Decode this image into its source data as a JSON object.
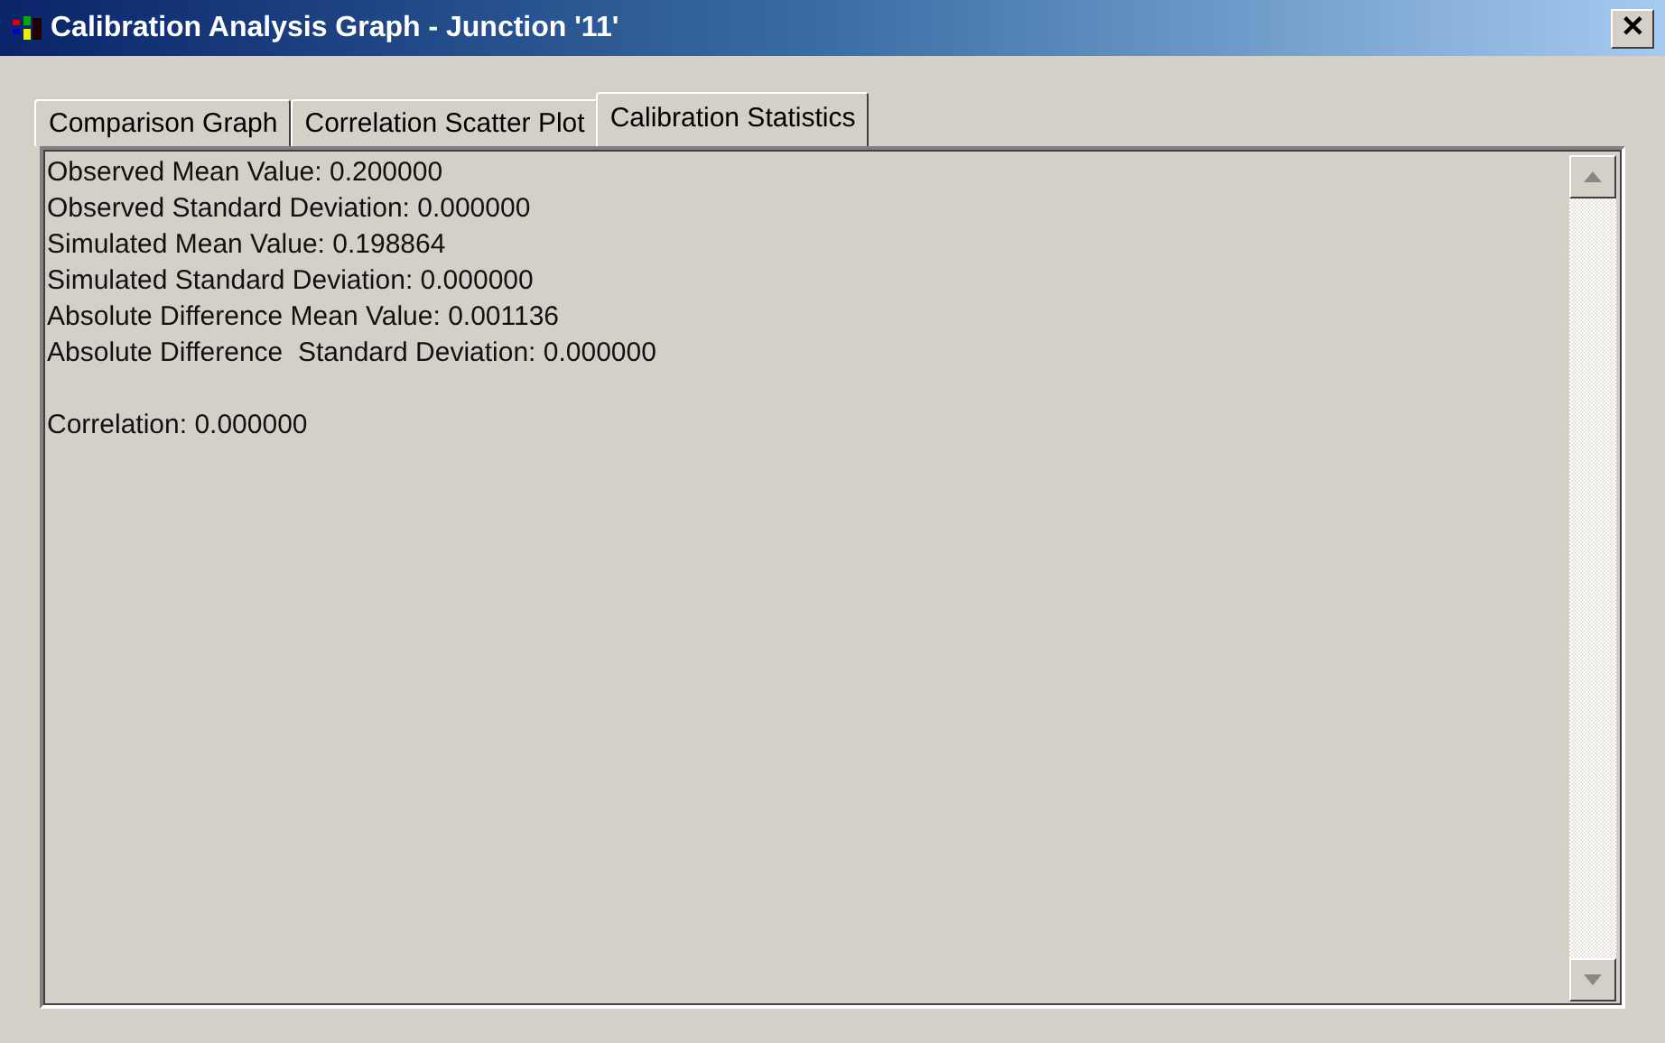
{
  "window": {
    "title": "Calibration Analysis Graph - Junction '11'",
    "close": "✕"
  },
  "tabs": [
    {
      "label": "Comparison Graph",
      "selected": false
    },
    {
      "label": "Correlation Scatter Plot",
      "selected": false
    },
    {
      "label": "Calibration Statistics",
      "selected": true
    }
  ],
  "statistics": [
    "Observed Mean Value: 0.200000",
    "Observed Standard Deviation: 0.000000",
    "Simulated Mean Value: 0.198864",
    "Simulated Standard Deviation: 0.000000",
    "Absolute Difference Mean Value: 0.001136",
    "Absolute Difference  Standard Deviation: 0.000000"
  ],
  "correlation": "Correlation: 0.000000"
}
